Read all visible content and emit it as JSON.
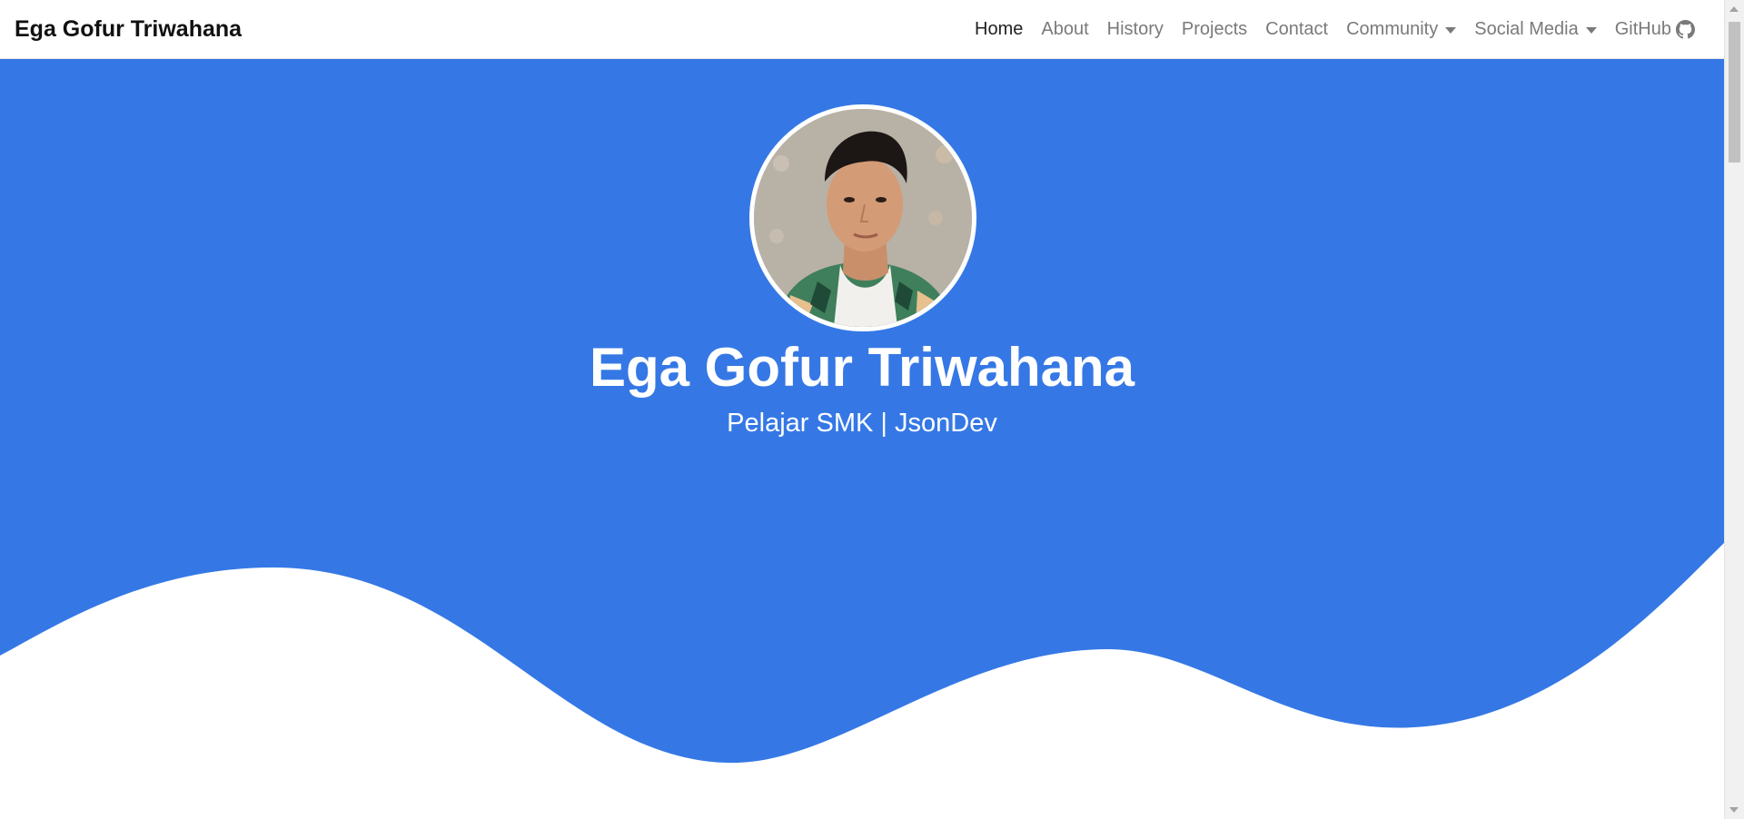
{
  "navbar": {
    "brand": "Ega Gofur Triwahana",
    "items": [
      {
        "label": "Home",
        "active": true
      },
      {
        "label": "About"
      },
      {
        "label": "History"
      },
      {
        "label": "Projects"
      },
      {
        "label": "Contact"
      },
      {
        "label": "Community",
        "dropdown": true
      },
      {
        "label": "Social Media",
        "dropdown": true
      },
      {
        "label": "GitHub",
        "icon": "github-icon"
      }
    ]
  },
  "hero": {
    "name": "Ega Gofur Triwahana",
    "subtitle": "Pelajar SMK | JsonDev",
    "avatar_icon": "profile-photo",
    "background_color": "#3578e5"
  },
  "colors": {
    "accent": "#3578e5",
    "nav_text": "#7a7a7a",
    "nav_active": "#222222"
  }
}
